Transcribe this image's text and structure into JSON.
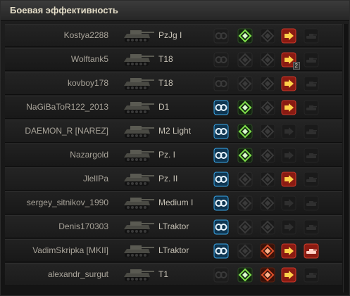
{
  "window": {
    "title": "Боевая эффективность"
  },
  "rows": [
    {
      "player": "Kostya2288",
      "tank": "PzJg I",
      "spotted": false,
      "damage": true,
      "crit": false,
      "kill": true,
      "kill_count": "",
      "destroyed": false
    },
    {
      "player": "Wolftank5",
      "tank": "T18",
      "spotted": false,
      "damage": false,
      "crit": false,
      "kill": true,
      "kill_count": "2",
      "destroyed": false
    },
    {
      "player": "kovboy178",
      "tank": "T18",
      "spotted": false,
      "damage": false,
      "crit": false,
      "kill": true,
      "kill_count": "",
      "destroyed": false
    },
    {
      "player": "NaGiBaToR122_2013",
      "tank": "D1",
      "spotted": true,
      "damage": true,
      "crit": false,
      "kill": true,
      "kill_count": "",
      "destroyed": false
    },
    {
      "player": "DAEMON_R [NAREZ]",
      "tank": "M2 Light",
      "spotted": true,
      "damage": true,
      "crit": false,
      "kill": false,
      "kill_count": "",
      "destroyed": false
    },
    {
      "player": "Nazargold",
      "tank": "Pz. I",
      "spotted": true,
      "damage": true,
      "crit": false,
      "kill": false,
      "kill_count": "",
      "destroyed": false
    },
    {
      "player": "JlelIPa",
      "tank": "Pz. II",
      "spotted": true,
      "damage": false,
      "crit": false,
      "kill": true,
      "kill_count": "",
      "destroyed": false
    },
    {
      "player": "sergey_sitnikov_1990",
      "tank": "Medium I",
      "spotted": true,
      "damage": false,
      "crit": false,
      "kill": false,
      "kill_count": "",
      "destroyed": false
    },
    {
      "player": "Denis170303",
      "tank": "LTraktor",
      "spotted": true,
      "damage": false,
      "crit": false,
      "kill": false,
      "kill_count": "",
      "destroyed": false
    },
    {
      "player": "VadimSkripka [MKII]",
      "tank": "LTraktor",
      "spotted": true,
      "damage": false,
      "crit": true,
      "kill": true,
      "kill_count": "",
      "destroyed": true
    },
    {
      "player": "alexandr_surgut",
      "tank": "T1",
      "spotted": false,
      "damage": true,
      "crit": true,
      "kill": true,
      "kill_count": "",
      "destroyed": false
    }
  ],
  "icons": {
    "spotted": "spotted-icon",
    "damage": "damage-icon",
    "crit": "critical-hit-icon",
    "kill": "kill-icon",
    "destroyed": "destroyed-icon",
    "tank": "tank-icon"
  },
  "colors": {
    "spotted": "#2a8fd0",
    "damage": "#7fe04a",
    "crit": "#e0502a",
    "kill": "#e8a02c",
    "inactive": "#3a3a3a"
  }
}
